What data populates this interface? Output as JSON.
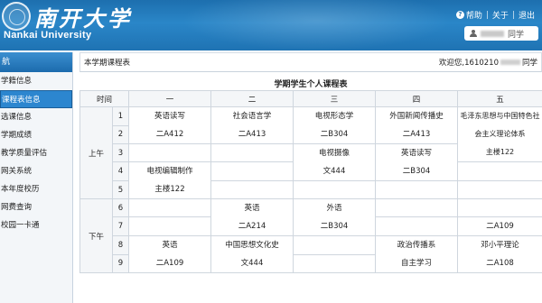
{
  "header": {
    "title_cn": "南开大学",
    "title_en": "Nankai University",
    "help_label": "帮助",
    "about_label": "关于",
    "logout_label": "退出",
    "user_suffix": "同学"
  },
  "sidebar": {
    "heading": "航",
    "items": [
      {
        "label": "学籍信息",
        "active": false
      },
      {
        "label": "课程表信息",
        "active": true
      },
      {
        "label": "选课信息",
        "active": false
      },
      {
        "label": "学期成绩",
        "active": false
      },
      {
        "label": "教学质量评估",
        "active": false
      },
      {
        "label": "网关系统",
        "active": false
      },
      {
        "label": "本年度校历",
        "active": false
      },
      {
        "label": "网费查询",
        "active": false
      },
      {
        "label": "校园一卡通",
        "active": false
      }
    ]
  },
  "main": {
    "breadcrumb": "本学期课程表",
    "welcome_prefix": "欢迎您,1610210",
    "welcome_suffix": "同学",
    "table_title": "学期学生个人课程表",
    "headers": {
      "time": "时间",
      "days": [
        "一",
        "二",
        "三",
        "四",
        "五"
      ]
    },
    "periods": {
      "morning": "上午",
      "afternoon": "下午"
    },
    "row_numbers": [
      "1",
      "2",
      "3",
      "4",
      "5",
      "6",
      "7",
      "8",
      "9"
    ],
    "courses": {
      "mon_12": {
        "name": "英语读写",
        "room": "二A412"
      },
      "tue_12": {
        "name": "社会语言学",
        "room": "二A413"
      },
      "wed_12": {
        "name": "电视形态学",
        "room": "二B304"
      },
      "thu_12": {
        "name": "外国新闻传播史",
        "room": "二A413"
      },
      "fri_12": {
        "name": "毛泽东思想与中国特色社",
        "name2": "会主义理论体系",
        "room": "主楼122"
      },
      "wed_34": {
        "name": "电视摄像",
        "room": "文444"
      },
      "thu_34": {
        "name": "英语读写",
        "room": "二B304"
      },
      "mon_45": {
        "name": "电视编辑制作",
        "room": "主楼122"
      },
      "tue_67": {
        "name": "英语",
        "room": "二A214"
      },
      "wed_67": {
        "name": "外语",
        "room": "二B304"
      },
      "fri_7": {
        "room": "二A109"
      },
      "mon_89": {
        "name": "英语",
        "room": "二A109"
      },
      "tue_89": {
        "name": "中国思想文化史",
        "room": "文444"
      },
      "thu_89": {
        "name": "政治传播系",
        "room": "自主学习"
      },
      "fri_89": {
        "name": "邓小平理论",
        "room": "二A108"
      }
    }
  }
}
